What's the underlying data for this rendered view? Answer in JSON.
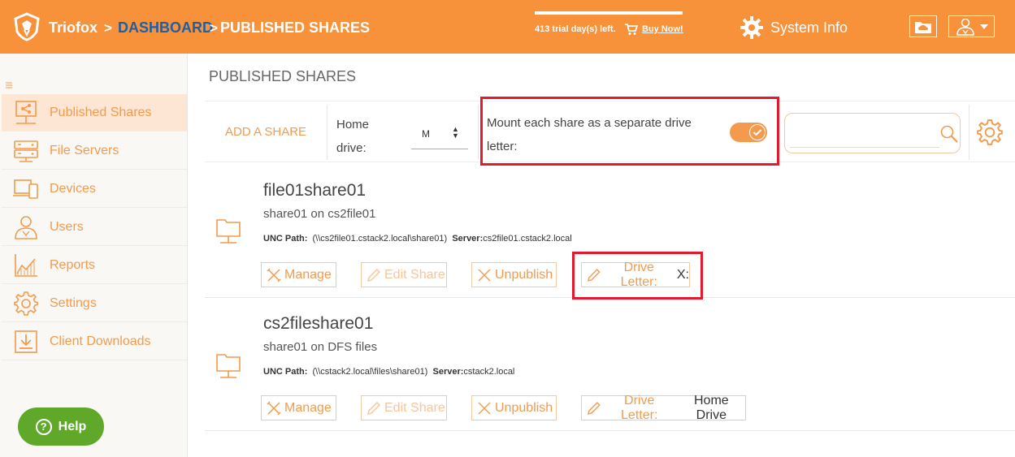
{
  "header": {
    "brand": "Triofox",
    "crumb_sep": ">",
    "crumb_dashboard": "DASHBOARD",
    "crumb_current": "PUBLISHED SHARES",
    "trial_text": "413 trial day(s) left.",
    "buy_now": "Buy Now!",
    "system_info": "System Info"
  },
  "sidebar": {
    "items": [
      {
        "label": "Published Shares",
        "icon": "share-icon"
      },
      {
        "label": "File Servers",
        "icon": "server-icon"
      },
      {
        "label": "Devices",
        "icon": "devices-icon"
      },
      {
        "label": "Users",
        "icon": "users-icon"
      },
      {
        "label": "Reports",
        "icon": "chart-icon"
      },
      {
        "label": "Settings",
        "icon": "gear-icon"
      },
      {
        "label": "Client Downloads",
        "icon": "download-icon"
      }
    ],
    "help": "Help"
  },
  "main": {
    "title": "PUBLISHED SHARES",
    "toolbar": {
      "add_share": "ADD A SHARE",
      "home_drive_label": "Home drive:",
      "home_drive_value": "M",
      "mount_label": "Mount each share as a separate drive letter:",
      "search_placeholder": ""
    },
    "shares": [
      {
        "name": "file01share01",
        "subtitle": "share01 on cs2file01",
        "unc_label": "UNC Path:",
        "unc_path": "(\\\\cs2file01.cstack2.local\\share01)",
        "server_label": "Server:",
        "server": "cs2file01.cstack2.local",
        "manage": "Manage",
        "edit_share": "Edit Share",
        "unpublish": "Unpublish",
        "drive_letter_label": "Drive Letter:",
        "drive_letter": "X:"
      },
      {
        "name": "cs2fileshare01",
        "subtitle": "share01 on DFS files",
        "unc_label": "UNC Path:",
        "unc_path": "(\\\\cstack2.local\\files\\share01)",
        "server_label": "Server:",
        "server": "cstack2.local",
        "manage": "Manage",
        "edit_share": "Edit Share",
        "unpublish": "Unpublish",
        "drive_letter_label": "Drive Letter:",
        "drive_letter": "Home Drive"
      }
    ]
  },
  "colors": {
    "header_bg": "#f7913a",
    "accent": "#f39a4d",
    "dashboard_link": "#1f5fa6",
    "help_bg": "#5fa82a",
    "highlight": "#e3192e"
  }
}
